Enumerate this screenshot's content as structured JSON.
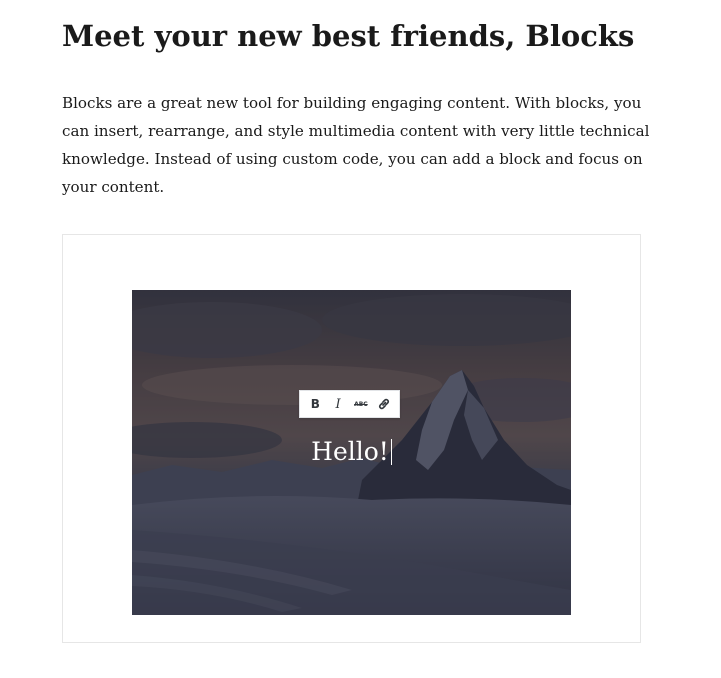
{
  "article": {
    "heading": "Meet your new best friends, Blocks",
    "paragraph": "Blocks are a great new tool for building engaging content. With blocks, you can insert, rearrange, and style multimedia content with very little technical knowledge. Instead of using custom code, you can add a block and focus on your content."
  },
  "cover_block": {
    "text": "Hello!",
    "overlay_color": "#2e3040"
  },
  "toolbar": {
    "bold_label": "B",
    "italic_label": "I",
    "strikethrough_label": "ABC",
    "link_icon": "link-icon"
  },
  "colors": {
    "text": "#1a1a1a",
    "frame_border": "#e6e6e6",
    "toolbar_bg": "#ffffff",
    "toolbar_icon": "#32373c"
  }
}
